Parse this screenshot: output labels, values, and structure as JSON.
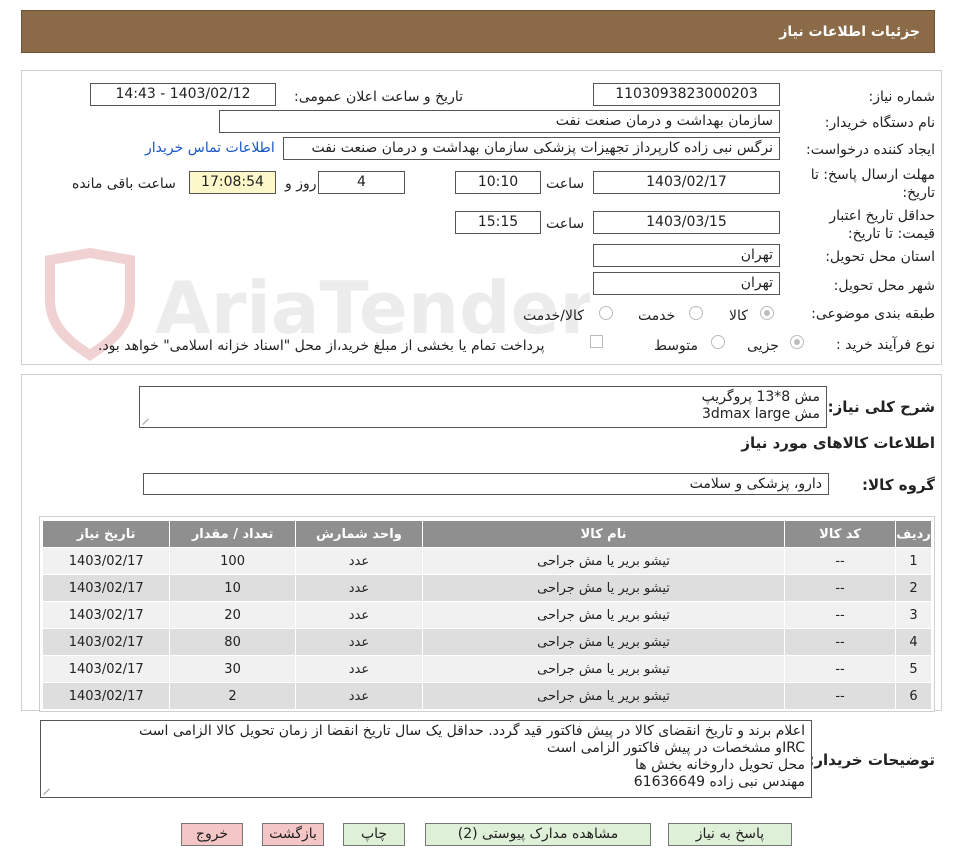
{
  "header": {
    "title": "جزئیات اطلاعات نیاز"
  },
  "form": {
    "need_number_label": "شماره نیاز:",
    "need_number": "1103093823000203",
    "announce_label": "تاریخ و ساعت اعلان عمومی:",
    "announce_value": "1403/02/12 - 14:43",
    "buyer_label": "نام دستگاه خریدار:",
    "buyer_value": "سازمان بهداشت و درمان صنعت نفت",
    "creator_label": "ایجاد کننده درخواست:",
    "creator_value": "نرگس نبی زاده کارپرداز تجهیزات پزشکی سازمان بهداشت و درمان صنعت نفت",
    "contact_link": "اطلاعات تماس خریدار",
    "deadline_label": "مهلت ارسال پاسخ: تا تاریخ:",
    "deadline_date": "1403/02/17",
    "time_label": "ساعت",
    "deadline_time": "10:10",
    "days_value": "4",
    "days_label": "روز و",
    "remaining_time": "17:08:54",
    "remaining_label": "ساعت باقی مانده",
    "validity_label": "حداقل تاریخ اعتبار قیمت: تا تاریخ:",
    "validity_date": "1403/03/15",
    "validity_time_label": "ساعت",
    "validity_time": "15:15",
    "province_label": "استان محل تحویل:",
    "province_value": "تهران",
    "city_label": "شهر محل تحویل:",
    "city_value": "تهران",
    "category_label": "طبقه بندی موضوعی:",
    "category_options": [
      "کالا",
      "خدمت",
      "کالا/خدمت"
    ],
    "process_label": "نوع فرآیند خرید :",
    "process_options": [
      "جزیی",
      "متوسط"
    ],
    "payment_note": "پرداخت تمام یا بخشی از مبلغ خرید،از محل \"اسناد خزانه اسلامی\" خواهد بود."
  },
  "summary": {
    "label": "شرح کلی نیاز:",
    "line1": "مش 8*13 پروگریپ",
    "line2": "مش 3dmax large",
    "goods_info_title": "اطلاعات کالاهای مورد نیاز",
    "group_label": "گروه کالا:",
    "group_value": "دارو، پزشکی و سلامت"
  },
  "table": {
    "headers": [
      "ردیف",
      "کد کالا",
      "نام کالا",
      "واحد شمارش",
      "تعداد / مقدار",
      "تاریخ نیاز"
    ],
    "rows": [
      [
        "1",
        "--",
        "تیشو بریر یا مش جراحی",
        "عدد",
        "100",
        "1403/02/17"
      ],
      [
        "2",
        "--",
        "تیشو بریر یا مش جراحی",
        "عدد",
        "10",
        "1403/02/17"
      ],
      [
        "3",
        "--",
        "تیشو بریر یا مش جراحی",
        "عدد",
        "20",
        "1403/02/17"
      ],
      [
        "4",
        "--",
        "تیشو بریر یا مش جراحی",
        "عدد",
        "80",
        "1403/02/17"
      ],
      [
        "5",
        "--",
        "تیشو بریر یا مش جراحی",
        "عدد",
        "30",
        "1403/02/17"
      ],
      [
        "6",
        "--",
        "تیشو بریر یا مش جراحی",
        "عدد",
        "2",
        "1403/02/17"
      ]
    ]
  },
  "notes": {
    "label": "توضیحات خریدار:",
    "line1": "اعلام برند و تاریخ انقضای کالا در پیش فاکتور قید گردد. حداقل یک سال تاریخ انقضا از زمان تحویل کالا  الزامی است",
    "line2": "IRCو مشخصات در پیش فاکتور الزامی است",
    "line3": "محل تحویل داروخانه بخش ها",
    "line4": "مهندس نبی زاده 61636649"
  },
  "buttons": {
    "reply": "پاسخ به نیاز",
    "attachments": "مشاهده مدارک پیوستی (2)",
    "print": "چاپ",
    "back": "بازگشت",
    "exit": "خروج"
  },
  "watermark": {
    "text": "AriaTender.neT"
  },
  "colors": {
    "header_bg": "#8b6a47",
    "table_header_bg": "#8f8f8f",
    "link": "#1a56c7",
    "green_button": "#dff0d8",
    "red_button": "#f5c6c6"
  }
}
